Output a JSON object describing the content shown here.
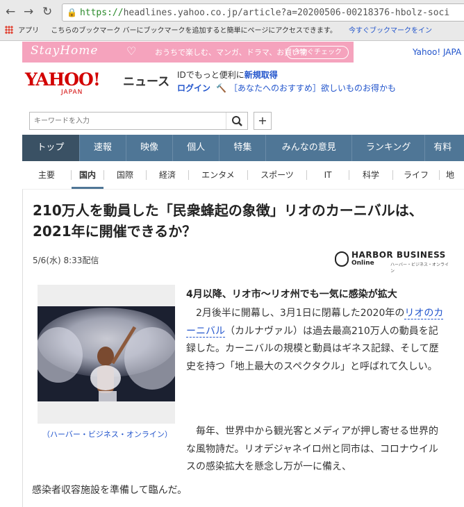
{
  "browser": {
    "url_scheme": "https://",
    "url_rest": "headlines.yahoo.co.jp/article?a=20200506-00218376-hbolz-soci",
    "bookmarks_apps": "アプリ",
    "bookmarks_info": "こちらのブックマーク バーにブックマークを追加すると簡単にページにアクセスできます。",
    "bookmarks_link": "今すぐブックマークをイン"
  },
  "banner": {
    "stay_home": "StayHome",
    "text": "おうちで楽しむ、マンガ、ドラマ、お買い物",
    "button": "今すぐチェック",
    "yahoo_japan": "Yahoo! JAPA"
  },
  "header": {
    "logo_main": "YAHOO!",
    "logo_sub": "JAPAN",
    "news": "ニュース",
    "id_text": "IDでもっと便利に",
    "register": "新規取得",
    "login": "ログイン",
    "recommend": "［あなたへのおすすめ］欲しいものお得かも"
  },
  "search": {
    "placeholder": "キーワードを入力"
  },
  "nav": [
    "トップ",
    "速報",
    "映像",
    "個人",
    "特集",
    "みんなの意見",
    "ランキング",
    "有料"
  ],
  "subnav": [
    "主要",
    "国内",
    "国際",
    "経済",
    "エンタメ",
    "スポーツ",
    "IT",
    "科学",
    "ライフ",
    "地"
  ],
  "article": {
    "title": "210万人を動員した「民衆蜂起の象徴」リオのカーニバルは、2021年に開催できるか？",
    "date": "5/6(水) 8:33配信",
    "publisher_name": "HARBOR BUSINESS",
    "publisher_online": "Online",
    "publisher_sub": "ハーバー・ビジネス・オンライン",
    "caption": "（ハーバー・ビジネス・オンライン）",
    "subhead": "4月以降、リオ市〜リオ州でも一気に感染が拡大",
    "p1_a": "　2月後半に開幕し、3月1日に閉幕した2020年の",
    "p1_link": "リオのカーニバル",
    "p1_b": "（カルナヴァル）は過去最高210万人の動員を記録した。カーニバルの規模と動員はギネス記録、そして歴史を持つ「地上最大のスペクタクル」と呼ばれて久しい。",
    "p2": "　毎年、世界中から観光客とメディアが押し寄せる世界的な風物詩だ。リオデジャネイロ州と同市は、コロナウイルスの感染拡大を懸念し万が一に備え、",
    "p3": "感染者収容施設を準備して臨んだ。"
  }
}
